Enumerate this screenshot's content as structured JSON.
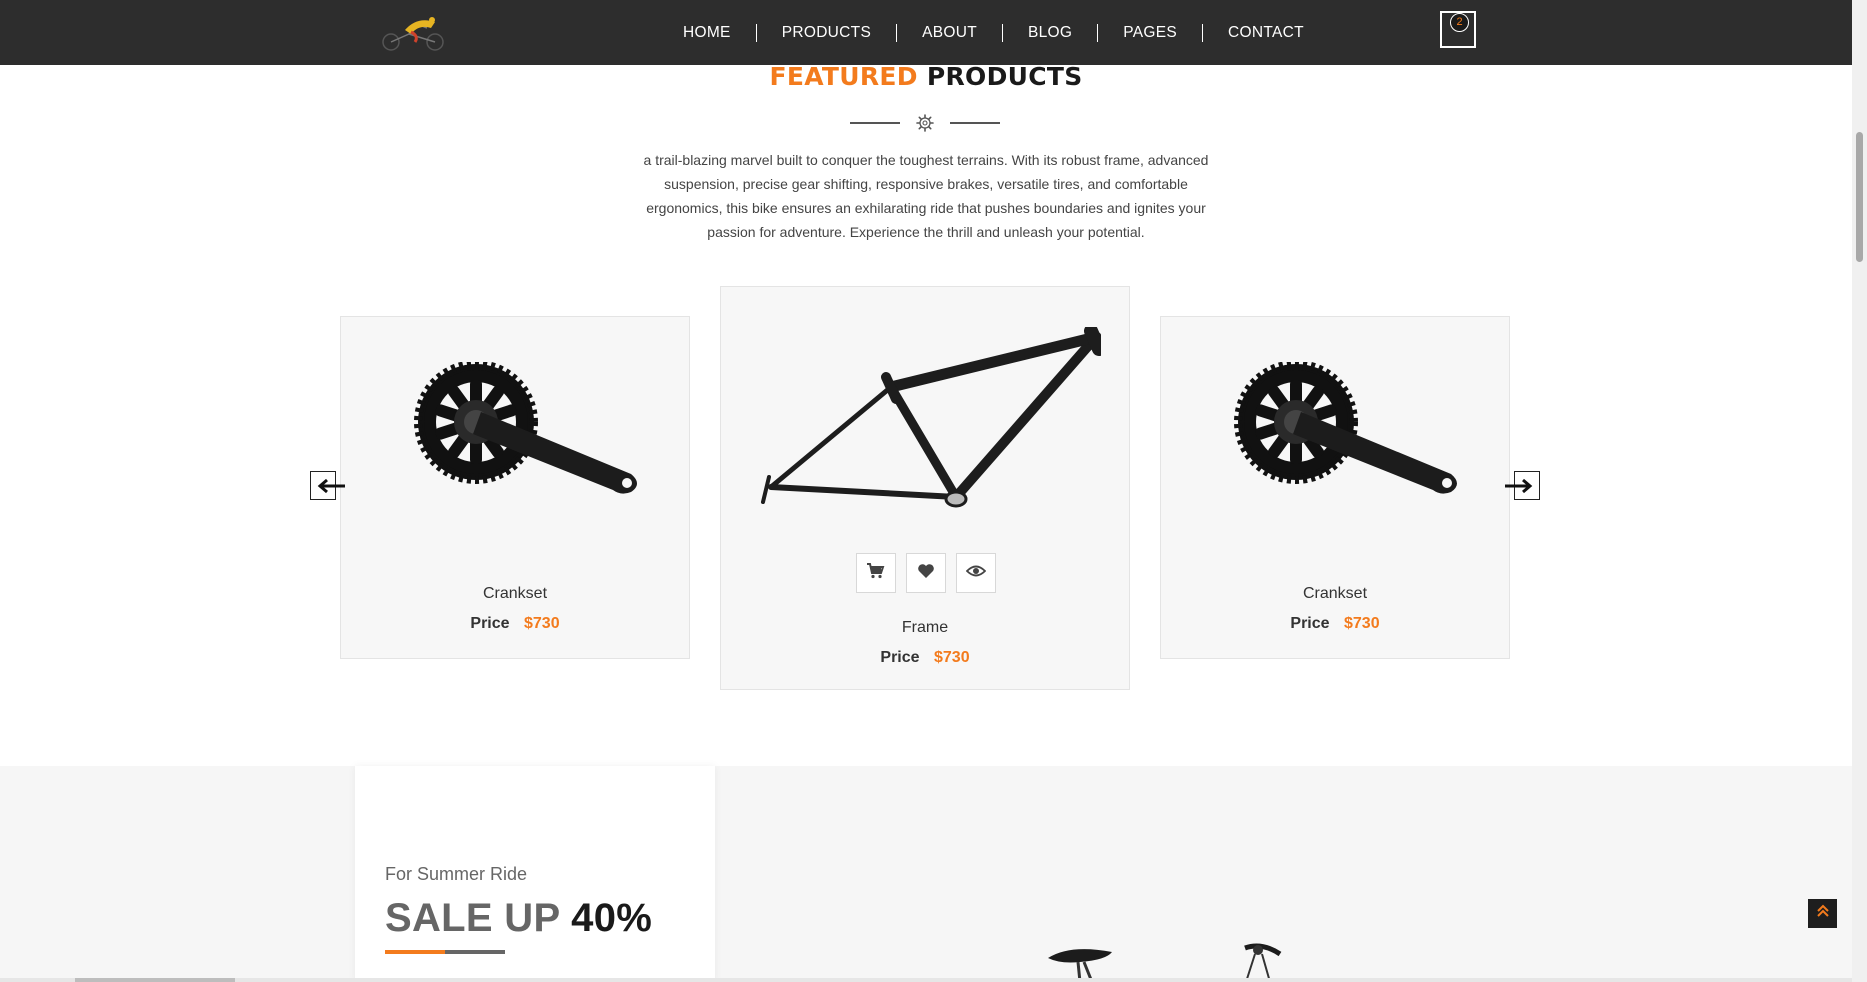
{
  "header": {
    "logo": "bike-rider-logo",
    "nav": [
      "HOME",
      "PRODUCTS",
      "ABOUT",
      "BLOG",
      "PAGES",
      "CONTACT"
    ],
    "cart_count": "2"
  },
  "featured": {
    "title_accent": "FEATURED",
    "title_rest": "PRODUCTS",
    "description": "a trail-blazing marvel built to conquer the toughest terrains. With its robust frame, advanced suspension, precise gear shifting, responsive brakes, versatile tires, and comfortable ergonomics, this bike ensures an exhilarating ride that pushes boundaries and ignites your passion for adventure. Experience the thrill and unleash your potential."
  },
  "products": [
    {
      "name": "Crankset",
      "price_label": "Price",
      "price": "$730",
      "image": "crankset"
    },
    {
      "name": "Frame",
      "price_label": "Price",
      "price": "$730",
      "image": "bike-frame"
    },
    {
      "name": "Crankset",
      "price_label": "Price",
      "price": "$730",
      "image": "crankset"
    }
  ],
  "product_actions": [
    "cart-icon",
    "heart-icon",
    "eye-icon"
  ],
  "sale": {
    "kicker": "For Summer Ride",
    "heading_grey": "SALE UP",
    "heading_dark": "40%"
  },
  "colors": {
    "accent": "#f37b1d",
    "header_bg": "#2d2d2d",
    "card_bg": "#f7f7f7"
  }
}
